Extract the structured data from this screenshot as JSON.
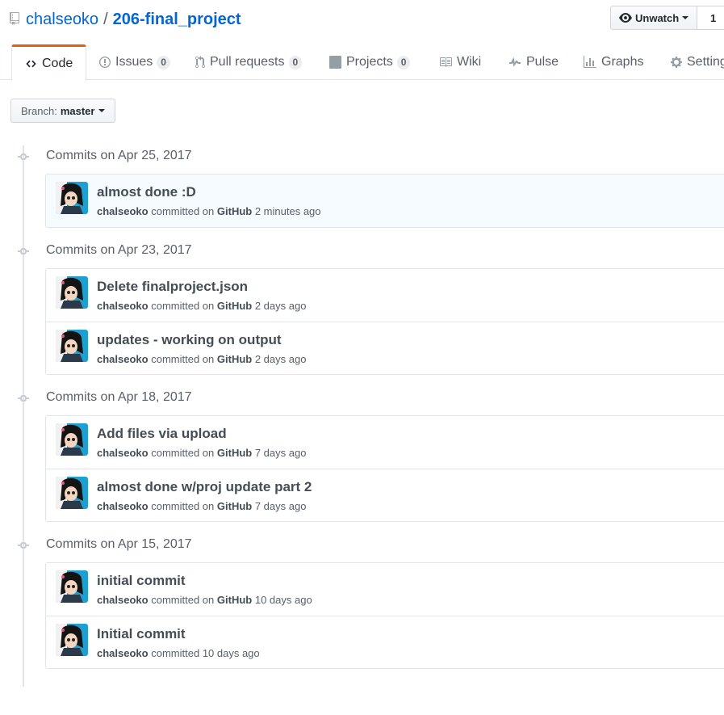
{
  "repo": {
    "owner": "chalseoko",
    "separator": "/",
    "name": "206-final_project"
  },
  "watch": {
    "label": "Unwatch",
    "count": "1"
  },
  "tabs": [
    {
      "label": "Code",
      "icon": "code-icon",
      "selected": true
    },
    {
      "label": "Issues",
      "icon": "issue-icon",
      "count": "0"
    },
    {
      "label": "Pull requests",
      "icon": "pull-request-icon",
      "count": "0"
    },
    {
      "label": "Projects",
      "icon": "project-icon",
      "count": "0"
    },
    {
      "label": "Wiki",
      "icon": "book-icon"
    },
    {
      "label": "Pulse",
      "icon": "pulse-icon"
    },
    {
      "label": "Graphs",
      "icon": "graph-icon"
    },
    {
      "label": "Settings",
      "icon": "gear-icon"
    }
  ],
  "branch": {
    "prefix": "Branch:",
    "name": "master"
  },
  "groups": [
    {
      "heading": "Commits on Apr 25, 2017",
      "commits": [
        {
          "message": "almost done :D",
          "author": "chalseoko",
          "verb": "committed on",
          "platform": "GitHub",
          "time": "2 minutes ago"
        }
      ]
    },
    {
      "heading": "Commits on Apr 23, 2017",
      "commits": [
        {
          "message": "Delete finalproject.json",
          "author": "chalseoko",
          "verb": "committed on",
          "platform": "GitHub",
          "time": "2 days ago"
        },
        {
          "message": "updates - working on output",
          "author": "chalseoko",
          "verb": "committed on",
          "platform": "GitHub",
          "time": "2 days ago"
        }
      ]
    },
    {
      "heading": "Commits on Apr 18, 2017",
      "commits": [
        {
          "message": "Add files via upload",
          "author": "chalseoko",
          "verb": "committed on",
          "platform": "GitHub",
          "time": "7 days ago"
        },
        {
          "message": "almost done w/proj update part 2",
          "author": "chalseoko",
          "verb": "committed on",
          "platform": "GitHub",
          "time": "7 days ago"
        }
      ]
    },
    {
      "heading": "Commits on Apr 15, 2017",
      "commits": [
        {
          "message": "initial commit",
          "author": "chalseoko",
          "verb": "committed on",
          "platform": "GitHub",
          "time": "10 days ago"
        },
        {
          "message": "Initial commit",
          "author": "chalseoko",
          "verb": "committed",
          "platform": "",
          "time": "10 days ago"
        }
      ]
    }
  ],
  "colors": {
    "link": "#0366d6",
    "tab_accent": "#e36209",
    "border": "#e1e4e8",
    "highlight_bg": "#f6fbff"
  }
}
